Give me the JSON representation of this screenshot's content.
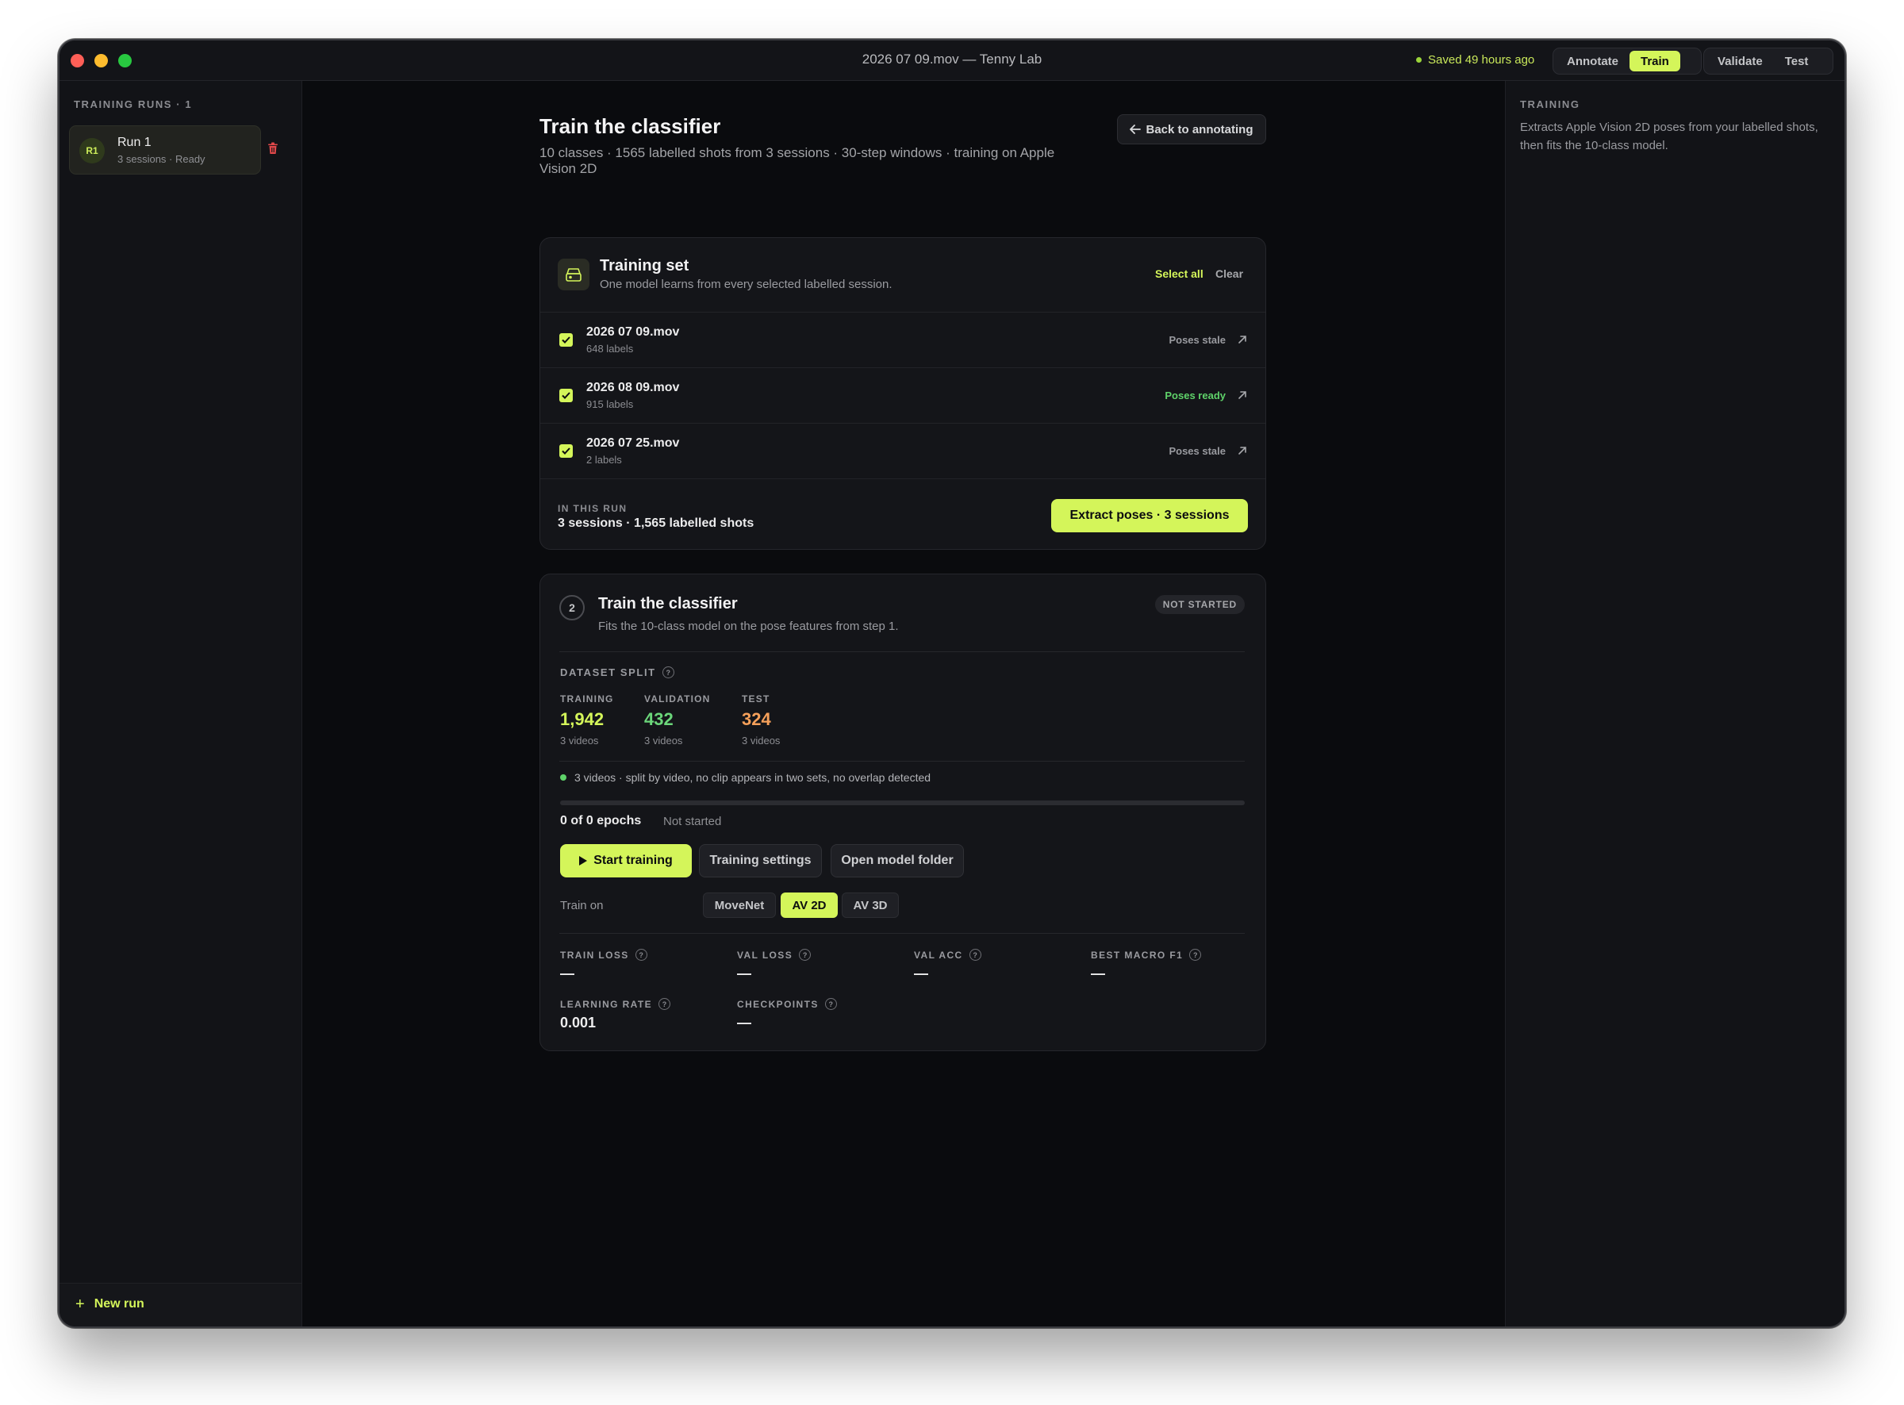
{
  "window": {
    "title": "2026 07 09.mov — Tenny Lab",
    "saved_status": "Saved 49 hours ago"
  },
  "nav": {
    "tabs": [
      {
        "label": "Annotate",
        "active": false
      },
      {
        "label": "Train",
        "active": true
      },
      {
        "label": "Validate",
        "active": false
      },
      {
        "label": "Test",
        "active": false
      }
    ]
  },
  "sidebar": {
    "heading": "TRAINING RUNS · 1",
    "runs": [
      {
        "badge": "R1",
        "name": "Run 1",
        "sub": "3 sessions · Ready"
      }
    ],
    "new_run_label": "New run"
  },
  "right_panel": {
    "heading": "TRAINING",
    "text": "Extracts Apple Vision 2D poses from your labelled shots, then fits the 10-class model."
  },
  "main": {
    "title": "Train the classifier",
    "subtitle": "10 classes · 1565 labelled shots from 3 sessions · 30-step windows · training on Apple Vision 2D",
    "back_label": "Back to annotating"
  },
  "training_set": {
    "title": "Training set",
    "subtitle": "One model learns from every selected labelled session.",
    "select_all": "Select all",
    "clear": "Clear",
    "sessions": [
      {
        "name": "2026 07 09.mov",
        "labels": "648 labels",
        "status": "Poses stale",
        "checked": true
      },
      {
        "name": "2026 08 09.mov",
        "labels": "915 labels",
        "status": "Poses ready",
        "checked": true
      },
      {
        "name": "2026 07 25.mov",
        "labels": "2 labels",
        "status": "Poses stale",
        "checked": true
      }
    ],
    "in_run_label": "IN THIS RUN",
    "in_run_value": "3 sessions · 1,565 labelled shots",
    "extract_label": "Extract poses · 3 sessions"
  },
  "train_step": {
    "number": "2",
    "title": "Train the classifier",
    "subtitle": "Fits the 10-class model on the pose features from step 1.",
    "status_badge": "NOT STARTED",
    "dataset_split_label": "DATASET SPLIT",
    "split": {
      "training": {
        "label": "TRAINING",
        "value": "1,942",
        "sub": "3 videos"
      },
      "validation": {
        "label": "VALIDATION",
        "value": "432",
        "sub": "3 videos"
      },
      "test": {
        "label": "TEST",
        "value": "324",
        "sub": "3 videos"
      }
    },
    "split_note": "3 videos · split by video, no clip appears in two sets, no overlap detected",
    "progress_fraction": 0,
    "epochs_label": "0 of 0 epochs",
    "epochs_status": "Not started",
    "buttons": {
      "start": "Start training",
      "settings": "Training settings",
      "folder": "Open model folder"
    },
    "train_on_label": "Train on",
    "train_on_options": [
      {
        "label": "MoveNet",
        "active": false
      },
      {
        "label": "AV 2D",
        "active": true
      },
      {
        "label": "AV 3D",
        "active": false
      }
    ],
    "metrics": {
      "train_loss": {
        "label": "TRAIN LOSS",
        "value": "—"
      },
      "val_loss": {
        "label": "VAL LOSS",
        "value": "—"
      },
      "val_acc": {
        "label": "VAL ACC",
        "value": "—"
      },
      "best_macro_f1": {
        "label": "BEST MACRO F1",
        "value": "—"
      },
      "learning_rate": {
        "label": "LEARNING RATE",
        "value": "0.001"
      },
      "checkpoints": {
        "label": "CHECKPOINTS",
        "value": "—"
      }
    },
    "help_glyph": "?"
  },
  "colors": {
    "accent": "#d4f55a",
    "validation": "#6bd67a",
    "test": "#f5a05a",
    "danger": "#e0484a"
  }
}
